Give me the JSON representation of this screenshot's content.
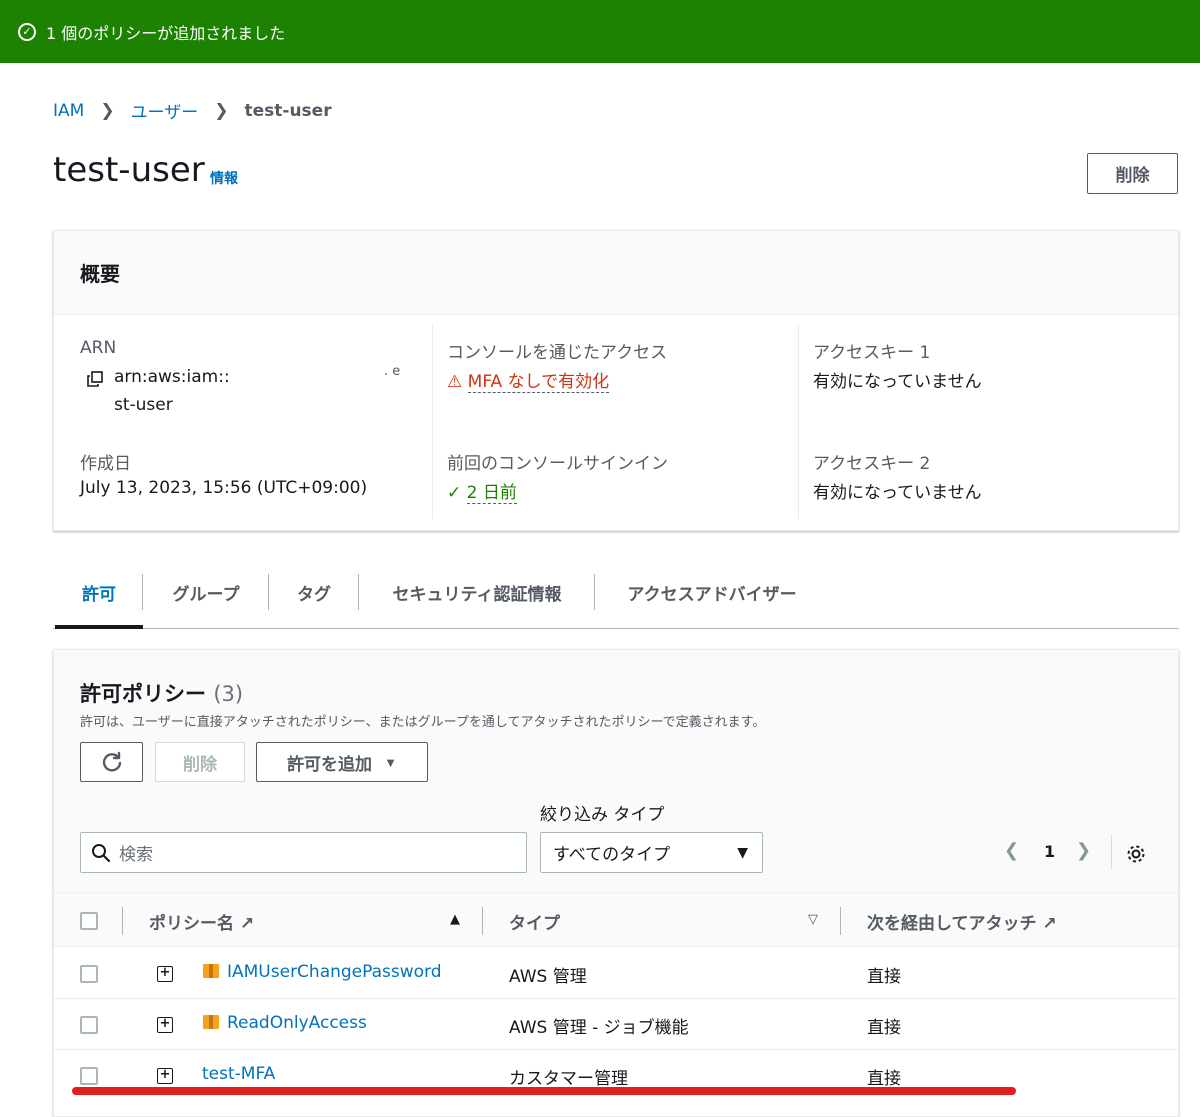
{
  "flash": {
    "message": "1 個のポリシーが追加されました"
  },
  "breadcrumb": {
    "items": [
      "IAM",
      "ユーザー"
    ],
    "current": "test-user"
  },
  "header": {
    "title": "test-user",
    "info": "情報",
    "delete_label": "削除"
  },
  "summary": {
    "title": "概要",
    "arn_label": "ARN",
    "arn_line1": "arn:aws:iam::",
    "arn_fragment": ". e",
    "arn_line2": "st-user",
    "created_label": "作成日",
    "created_value": "July 13, 2023, 15:56 (UTC+09:00)",
    "console_access_label": "コンソールを通じたアクセス",
    "console_access_value": "MFA なしで有効化",
    "last_signin_label": "前回のコンソールサインイン",
    "last_signin_value": "2 日前",
    "key1_label": "アクセスキー 1",
    "key1_value": "有効になっていません",
    "key2_label": "アクセスキー 2",
    "key2_value": "有効になっていません"
  },
  "tabs": [
    "許可",
    "グループ",
    "タグ",
    "セキュリティ認証情報",
    "アクセスアドバイザー"
  ],
  "policies": {
    "title": "許可ポリシー",
    "count": "(3)",
    "description": "許可は、ユーザーに直接アタッチされたポリシー、またはグループを通してアタッチされたポリシーで定義されます。",
    "delete_label": "削除",
    "add_label": "許可を追加",
    "filter_label": "絞り込み タイプ",
    "search_placeholder": "検索",
    "filter_value": "すべてのタイプ",
    "page": "1",
    "columns": {
      "name": "ポリシー名",
      "type": "タイプ",
      "attached_via": "次を経由してアタッチ"
    },
    "rows": [
      {
        "name": "IAMUserChangePassword",
        "type": "AWS 管理",
        "attached": "直接",
        "aws_managed": true
      },
      {
        "name": "ReadOnlyAccess",
        "type": "AWS 管理 - ジョブ機能",
        "attached": "直接",
        "aws_managed": true
      },
      {
        "name": "test-MFA",
        "type": "カスタマー管理",
        "attached": "直接",
        "aws_managed": false
      }
    ]
  },
  "colors": {
    "success": "#1d8102",
    "link": "#0073bb",
    "warning": "#d13212",
    "highlight": "#e01f1f"
  }
}
